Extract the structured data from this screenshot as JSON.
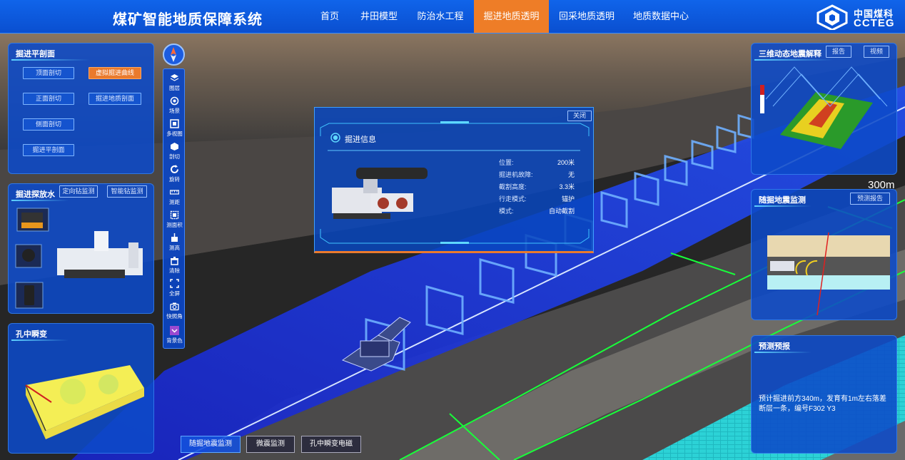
{
  "header": {
    "title": "煤矿智能地质保障系统",
    "nav": [
      {
        "label": "首页",
        "active": false
      },
      {
        "label": "井田模型",
        "active": false
      },
      {
        "label": "防治水工程",
        "active": false
      },
      {
        "label": "掘进地质透明",
        "active": true
      },
      {
        "label": "回采地质透明",
        "active": false
      },
      {
        "label": "地质数据中心",
        "active": false
      }
    ],
    "logo": {
      "cn": "中国煤科",
      "en": "CCTEG"
    }
  },
  "panel_section": {
    "title": "掘进平剖面",
    "buttons": [
      "顶面剖切",
      "虚拟掘进曲线",
      "正面剖切",
      "掘进地质剖面",
      "侧面剖切",
      "掘进平剖面"
    ]
  },
  "panel_drill": {
    "title": "掘进探放水",
    "buttons": [
      "定向钻监测",
      "智能钻监测"
    ]
  },
  "panel_hole": {
    "title": "孔中瞬变"
  },
  "toolbar": {
    "items": [
      "图层",
      "场景",
      "多视图",
      "剖切",
      "旋转",
      "测距",
      "测面积",
      "测高",
      "清除",
      "全屏",
      "快照角",
      "背景色"
    ]
  },
  "popup": {
    "close_label": "关闭",
    "title": "掘进信息",
    "rows": [
      {
        "key": "位置:",
        "value": "200米"
      },
      {
        "key": "掘进机故障:",
        "value": "无"
      },
      {
        "key": "截割高度:",
        "value": "3.3米"
      },
      {
        "key": "行走模式:",
        "value": "锚护"
      },
      {
        "key": "模式:",
        "value": "自动截割"
      }
    ]
  },
  "panel_seismic": {
    "title": "三维动态地震解释",
    "buttons": [
      "报告",
      "视频"
    ],
    "distance_label": "300m"
  },
  "panel_follow": {
    "title": "随掘地震监测",
    "button": "预测报告"
  },
  "panel_forecast": {
    "title": "预测预报",
    "text": "预计掘进前方340m，发育有1m左右落差断层一条，编号F302 Y3"
  },
  "bottom_tabs": [
    {
      "label": "随掘地震监测",
      "active": true
    },
    {
      "label": "微震监测",
      "active": false
    },
    {
      "label": "孔中瞬变电磁",
      "active": false
    }
  ],
  "colors": {
    "header": "#0a55dc",
    "accent": "#ea7a2d",
    "panel": "#0c4ac8",
    "tunnel": "#1a2ad8",
    "grid": "#18ff3a"
  }
}
